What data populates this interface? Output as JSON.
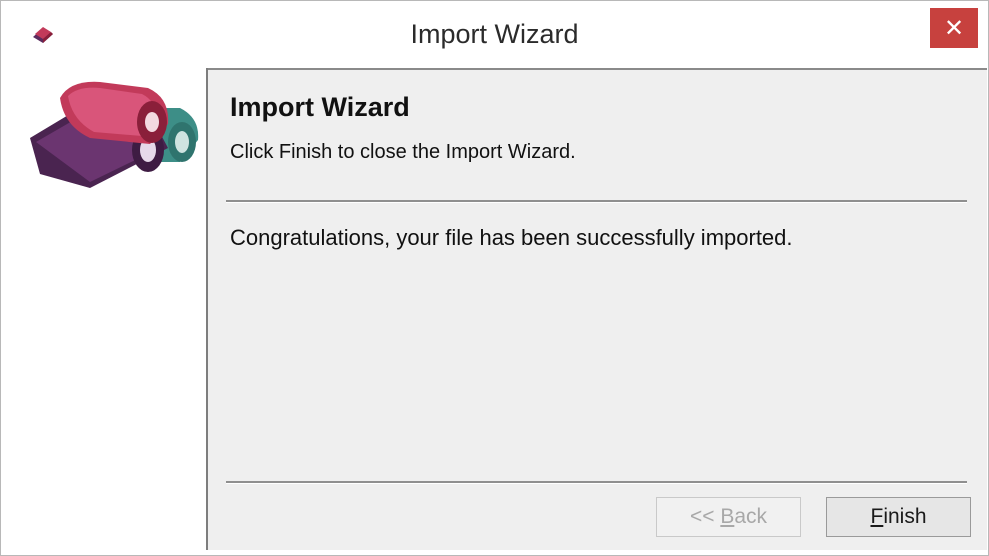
{
  "window": {
    "title": "Import Wizard",
    "close_label": "✕"
  },
  "header": {
    "title": "Import Wizard",
    "subtitle": "Click Finish to close the Import Wizard."
  },
  "body": {
    "message": "Congratulations, your file has been successfully imported."
  },
  "buttons": {
    "back": {
      "prefix": "<< ",
      "mnemonic": "B",
      "rest": "ack",
      "enabled": false
    },
    "finish": {
      "prefix": "",
      "mnemonic": "F",
      "rest": "inish",
      "enabled": true
    }
  },
  "icons": {
    "app": "app-books-icon",
    "wizard_image": "fabric-rolls-icon"
  },
  "colors": {
    "close_button": "#c7413e",
    "panel_background": "#efefef",
    "roll_red": "#c23a5a",
    "roll_purple": "#5b2b5e",
    "roll_teal": "#3d8e87"
  }
}
